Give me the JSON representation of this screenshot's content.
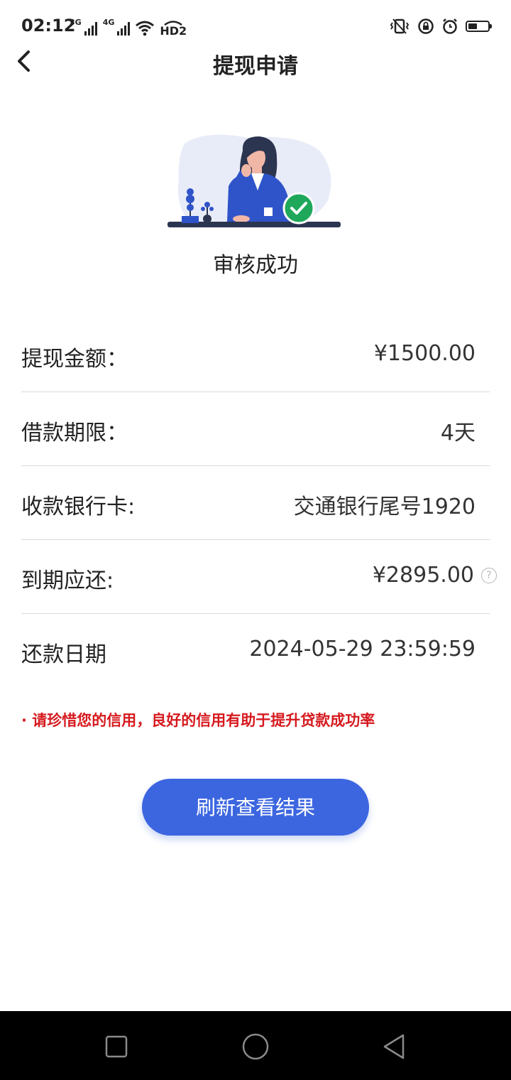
{
  "status_bar": {
    "time": "02:12",
    "net1": "3G",
    "net2": "4G",
    "hd_label": "HD2"
  },
  "nav": {
    "title": "提现申请"
  },
  "hero": {
    "status": "审核成功"
  },
  "details": {
    "amount_label": "提现金额：",
    "amount_value": "¥1500.00",
    "term_label": "借款期限：",
    "term_value": "4天",
    "card_label": "收款银行卡:",
    "card_value": "交通银行尾号1920",
    "due_label": "到期应还:",
    "due_value": "¥2895.00",
    "date_label": "还款日期",
    "date_value": "2024-05-29 23:59:59"
  },
  "note": "· 请珍惜您的信用，良好的信用有助于提升贷款成功率",
  "actions": {
    "refresh_label": "刷新查看结果"
  },
  "colors": {
    "accent": "#3c66e0",
    "warning": "#d6191e",
    "success": "#1fa85a"
  }
}
